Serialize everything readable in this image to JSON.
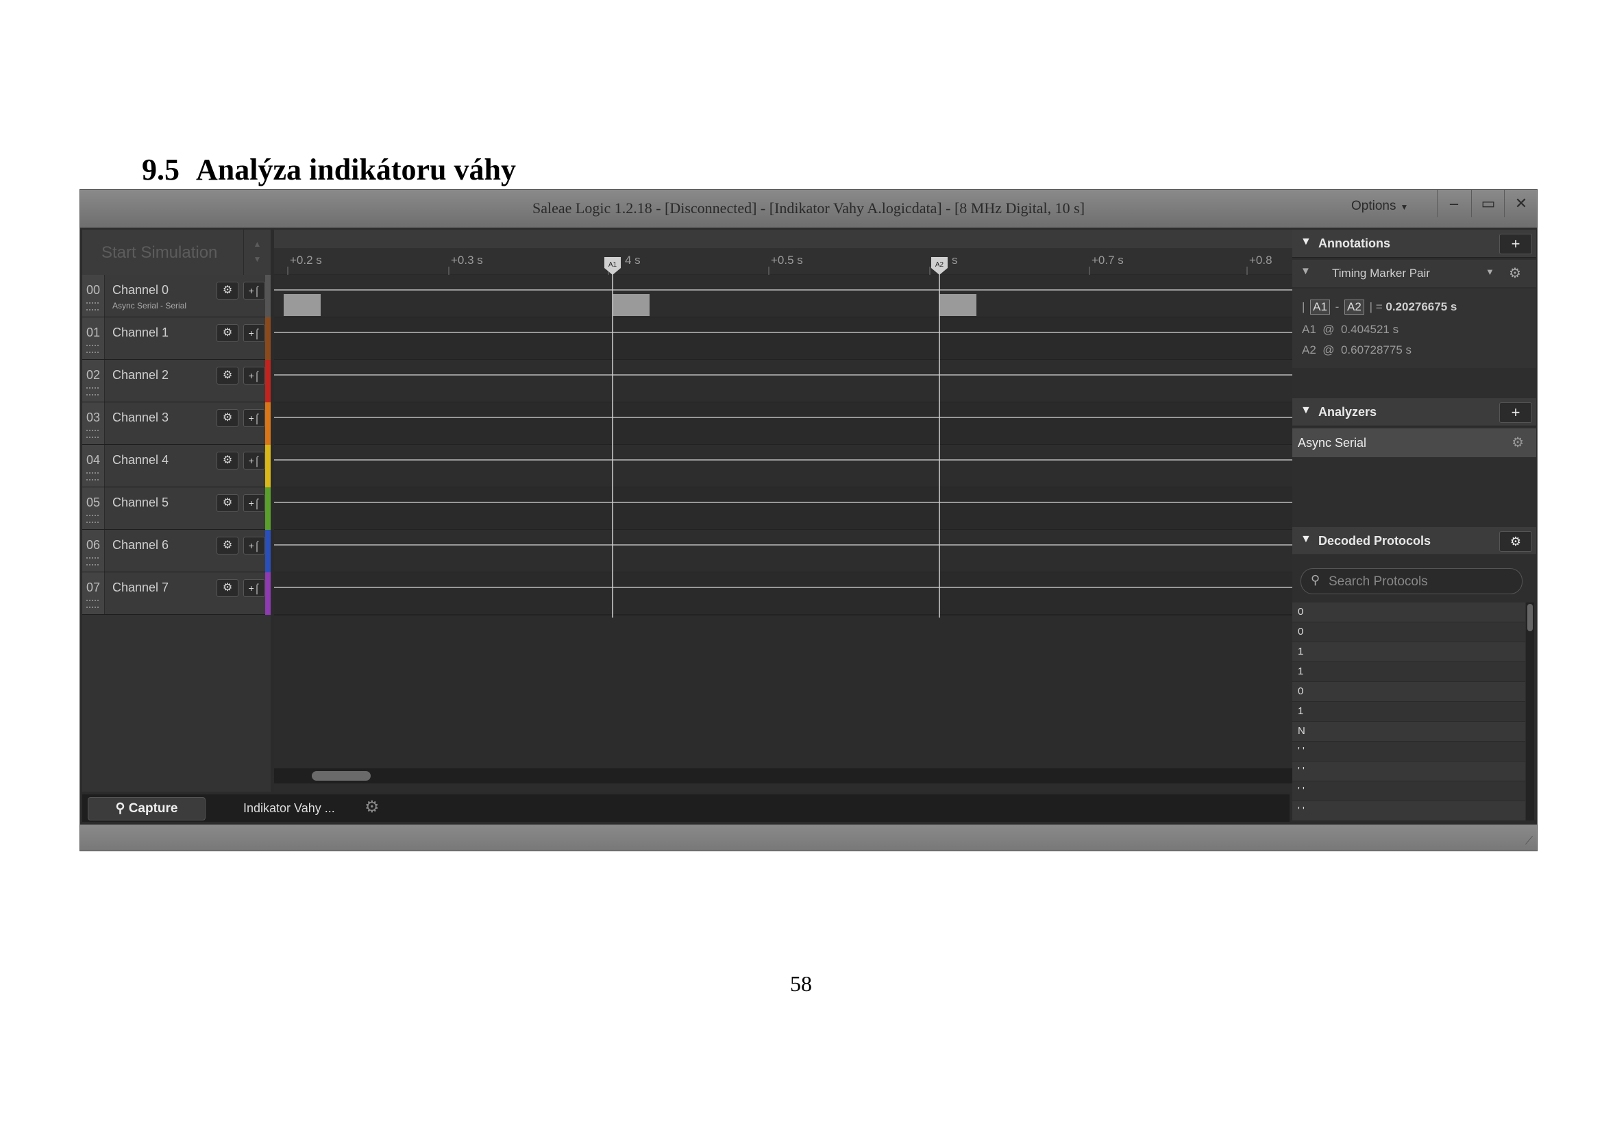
{
  "document": {
    "section_number": "9.5",
    "section_title": "Analýza indikátoru váhy",
    "page_number": "58"
  },
  "window": {
    "title": "Saleae Logic 1.2.18 - [Disconnected] - [Indikator Vahy A.logicdata] - [8 MHz Digital, 10 s]",
    "options_label": "Options",
    "minimize": "–",
    "maximize": "▭",
    "close": "✕"
  },
  "left_panel": {
    "start_simulation": "Start Simulation",
    "channels": [
      {
        "num": "00",
        "name": "Channel 0",
        "sub": "Async Serial - Serial",
        "color": "#555555"
      },
      {
        "num": "01",
        "name": "Channel 1",
        "sub": "",
        "color": "#8b4a1c"
      },
      {
        "num": "02",
        "name": "Channel 2",
        "sub": "",
        "color": "#c0241e"
      },
      {
        "num": "03",
        "name": "Channel 3",
        "sub": "",
        "color": "#d9761a"
      },
      {
        "num": "04",
        "name": "Channel 4",
        "sub": "",
        "color": "#d8b81a"
      },
      {
        "num": "05",
        "name": "Channel 5",
        "sub": "",
        "color": "#5aa02c"
      },
      {
        "num": "06",
        "name": "Channel 6",
        "sub": "",
        "color": "#2a4fb8"
      },
      {
        "num": "07",
        "name": "Channel 7",
        "sub": "",
        "color": "#8e3ab0"
      }
    ]
  },
  "timeline": {
    "ticks": [
      "+0.2 s",
      "+0.3 s",
      "4 s",
      "+0.5 s",
      "s",
      "+0.7 s",
      "+0.8"
    ],
    "markers": [
      "A1",
      "A2"
    ]
  },
  "tabs": {
    "capture": "Capture",
    "file": "Indikator Vahy ..."
  },
  "annotations": {
    "header": "Annotations",
    "add": "+",
    "timing_marker": "Timing Marker Pair",
    "diff_label_a": "A1",
    "diff_label_b": "A2",
    "diff_value": "0.20276675 s",
    "a1_label": "A1",
    "a1_value": "0.404521 s",
    "a2_label": "A2",
    "a2_value": "0.60728775 s"
  },
  "analyzers": {
    "header": "Analyzers",
    "add": "+",
    "items": [
      "Async Serial"
    ]
  },
  "decoded": {
    "header": "Decoded Protocols",
    "search_placeholder": "Search Protocols",
    "rows": [
      "0",
      "0",
      "1",
      "1",
      "0",
      "1",
      "N",
      "' '",
      "' '",
      "' '",
      "' '"
    ]
  }
}
